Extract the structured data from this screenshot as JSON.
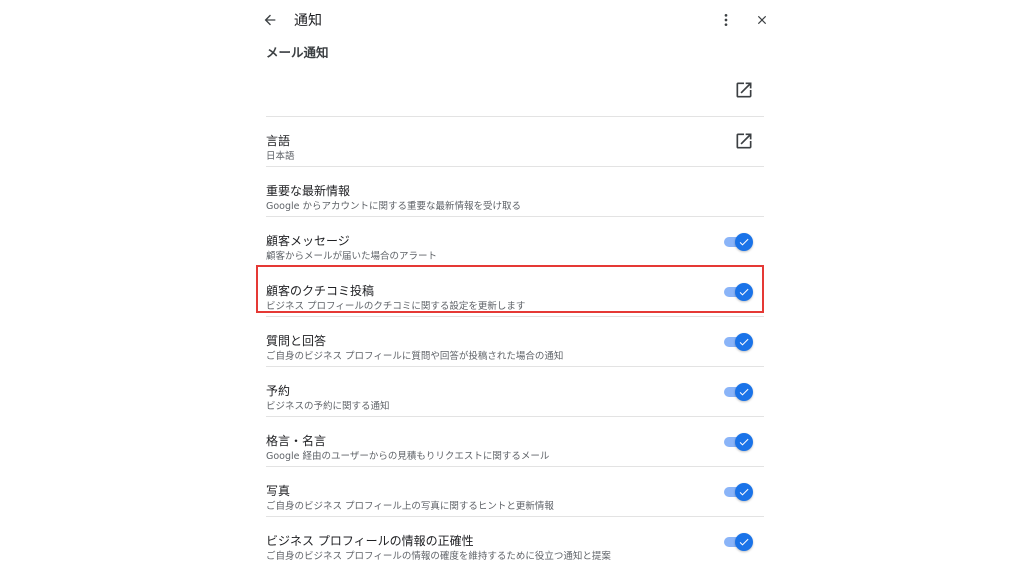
{
  "header": {
    "title": "通知",
    "back_icon": "arrow-left-icon",
    "more_icon": "more-vert-icon",
    "close_icon": "close-icon"
  },
  "section": {
    "title": "メール通知"
  },
  "rows": [
    {
      "label": "",
      "desc": "",
      "control": "external-link"
    },
    {
      "label": "言語",
      "desc": "日本語",
      "control": "external-link"
    },
    {
      "label": "重要な最新情報",
      "desc": "Google からアカウントに関する重要な最新情報を受け取る",
      "control": "none"
    },
    {
      "label": "顧客メッセージ",
      "desc": "顧客からメールが届いた場合のアラート",
      "control": "toggle-on"
    },
    {
      "label": "顧客のクチコミ投稿",
      "desc": "ビジネス プロフィールのクチコミに関する設定を更新します",
      "control": "toggle-on"
    },
    {
      "label": "質問と回答",
      "desc": "ご自身のビジネス プロフィールに質問や回答が投稿された場合の通知",
      "control": "toggle-on"
    },
    {
      "label": "予約",
      "desc": "ビジネスの予約に関する通知",
      "control": "toggle-on"
    },
    {
      "label": "格言・名言",
      "desc": "Google 経由のユーザーからの見積もりリクエストに関するメール",
      "control": "toggle-on"
    },
    {
      "label": "写真",
      "desc": "ご自身のビジネス プロフィール上の写真に関するヒントと更新情報",
      "control": "toggle-on"
    },
    {
      "label": "ビジネス プロフィールの情報の正確性",
      "desc": "ご自身のビジネス プロフィールの情報の確度を維持するために役立つ通知と提案",
      "control": "toggle-on"
    }
  ],
  "colors": {
    "toggle_knob": "#1a73e8",
    "toggle_track": "#8ab4f8",
    "highlight_border": "#e53935"
  }
}
